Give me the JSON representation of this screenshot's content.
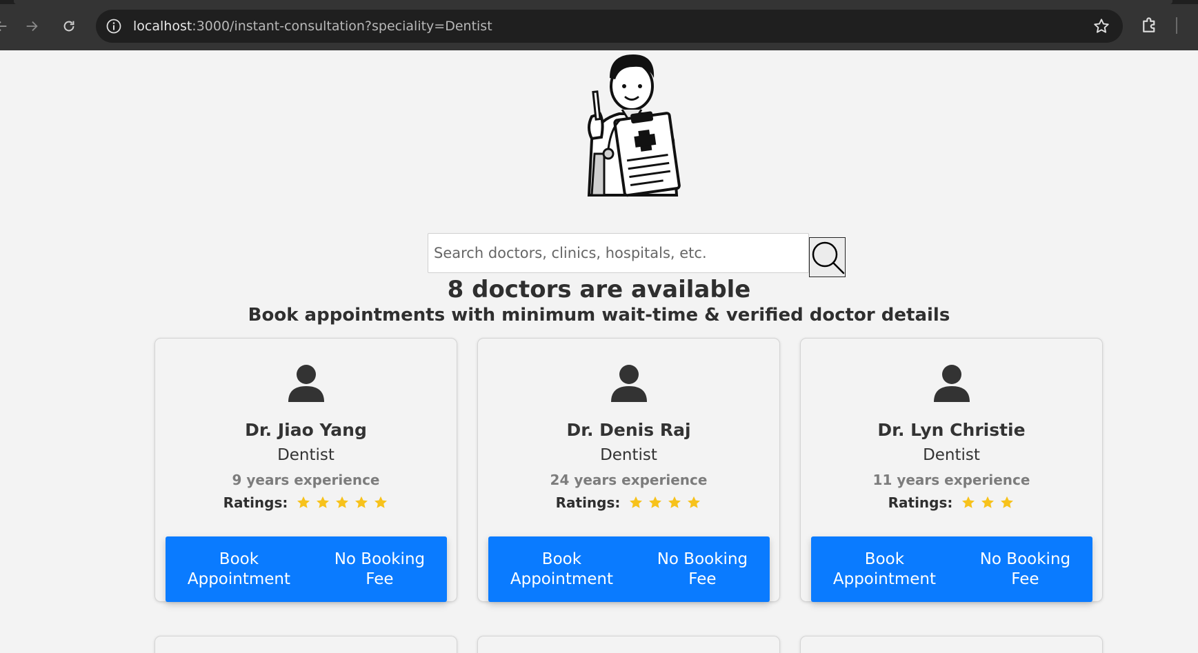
{
  "browser": {
    "url_host": "localhost",
    "url_path": ":3000/instant-consultation?speciality=Dentist"
  },
  "search": {
    "placeholder": "Search doctors, clinics, hospitals, etc."
  },
  "headings": {
    "count": "8 doctors are available",
    "subtitle": "Book appointments with minimum wait-time & verified doctor details"
  },
  "doctors": [
    {
      "name": "Dr. Jiao Yang",
      "speciality": "Dentist",
      "experience": "9 years experience",
      "ratings_label": "Ratings:",
      "rating": 5
    },
    {
      "name": "Dr. Denis Raj",
      "speciality": "Dentist",
      "experience": "24 years experience",
      "ratings_label": "Ratings:",
      "rating": 4
    },
    {
      "name": "Dr. Lyn Christie",
      "speciality": "Dentist",
      "experience": "11 years experience",
      "ratings_label": "Ratings:",
      "rating": 3
    }
  ],
  "button": {
    "book": "Book\nAppointment",
    "fee": "No Booking\nFee"
  },
  "colors": {
    "primary": "#0a7bff",
    "star": "#f7c21b",
    "page_bg": "#f3f3f3",
    "chrome_bg": "#343434"
  },
  "icons": [
    "back-icon",
    "forward-icon",
    "reload-icon",
    "info-icon",
    "star-icon",
    "extensions-icon",
    "search-icon",
    "user-icon"
  ]
}
